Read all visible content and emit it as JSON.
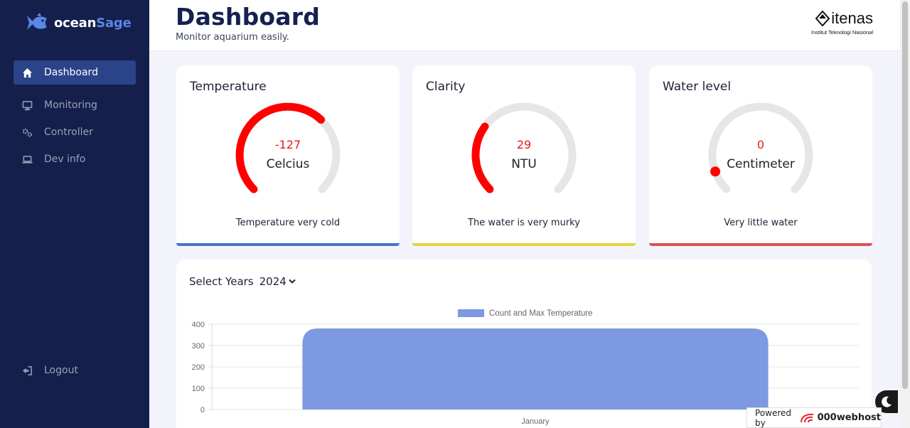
{
  "app": {
    "name_part1": "ocean",
    "name_part2": "Sage"
  },
  "sidebar": {
    "items": [
      {
        "label": "Dashboard",
        "icon": "home-icon",
        "active": true
      },
      {
        "label": "Monitoring",
        "icon": "monitor-icon",
        "active": false
      },
      {
        "label": "Controller",
        "icon": "gears-icon",
        "active": false
      },
      {
        "label": "Dev info",
        "icon": "laptop-icon",
        "active": false
      }
    ],
    "logout_label": "Logout"
  },
  "header": {
    "title": "Dashboard",
    "subtitle": "Monitor aquarium easily.",
    "brand_name": "itenas",
    "brand_sub": "Institut Teknologi Nasional"
  },
  "cards": [
    {
      "title": "Temperature",
      "value": "-127",
      "unit": "Celcius",
      "status": "Temperature very cold",
      "accent": "#4a72c9"
    },
    {
      "title": "Clarity",
      "value": "29",
      "unit": "NTU",
      "status": "The water is very murky",
      "accent": "#e2d43a"
    },
    {
      "title": "Water level",
      "value": "0",
      "unit": "Centimeter",
      "status": "Very little water",
      "accent": "#d9534f"
    }
  ],
  "gauge_colors": {
    "fill": "#ff0000",
    "track": "#e6e6e6"
  },
  "chart_controls": {
    "select_label": "Select Years",
    "selected_year": "2024"
  },
  "chart_data": {
    "type": "bar",
    "categories": [
      "January"
    ],
    "series": [
      {
        "name": "Count and Max Temperature",
        "values": [
          380
        ],
        "color": "#7d99e1"
      }
    ],
    "ylim": [
      0,
      400
    ],
    "yticks": [
      0,
      100,
      200,
      300,
      400
    ],
    "legend": "top-center",
    "grid": true
  },
  "footer": {
    "powered_label": "Powered by",
    "host_name": "000webhost"
  }
}
